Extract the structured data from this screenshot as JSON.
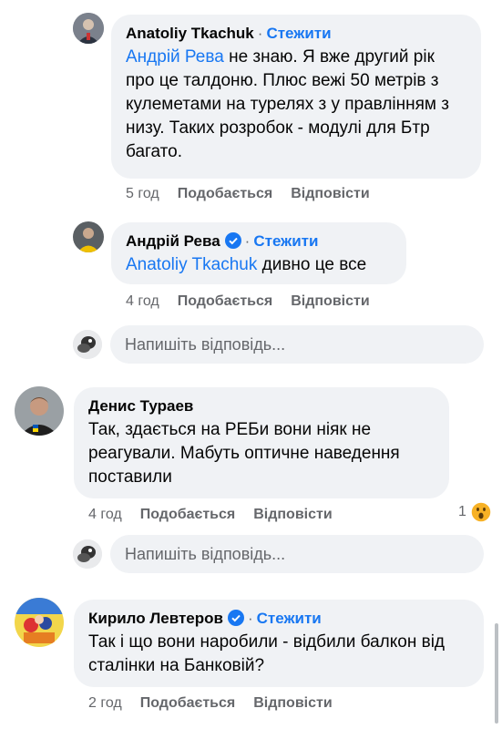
{
  "comments": [
    {
      "author": "Anatoliy Tkachuk",
      "follow_label": "Стежити",
      "mention": "Андрій Рева",
      "text": " не знаю. Я вже другий рік про це талдоню. Плюс вежі 50 метрів з кулеметами на турелях з у правлінням з низу. Таких розробок - модулі для Бтр багато.",
      "time": "5 год",
      "like_label": "Подобається",
      "reply_label": "Відповісти"
    },
    {
      "author": "Андрій Рева",
      "verified": true,
      "follow_label": "Стежити",
      "mention": "Anatoliy Tkachuk",
      "text": " дивно це все",
      "time": "4 год",
      "like_label": "Подобається",
      "reply_label": "Відповісти"
    },
    {
      "author": "Денис Тураев",
      "text": "Так, здається на РЕБи вони ніяк не реагували. Мабуть оптичне наведення поставили",
      "time": "4 год",
      "like_label": "Подобається",
      "reply_label": "Відповісти",
      "reaction_count": "1",
      "reaction_icon": "wow-reaction-icon"
    },
    {
      "author": "Кирило Левтеров",
      "verified": true,
      "follow_label": "Стежити",
      "text": "Так і що вони наробили - відбили балкон від сталінки на Банковій?",
      "time": "2 год",
      "like_label": "Подобається",
      "reply_label": "Відповісти"
    }
  ],
  "reply_boxes": [
    {
      "placeholder": "Напишіть відповідь..."
    },
    {
      "placeholder": "Напишіть відповідь..."
    }
  ],
  "colors": {
    "link": "#1877f2",
    "bubble": "#f0f2f5",
    "meta": "#65676b"
  }
}
